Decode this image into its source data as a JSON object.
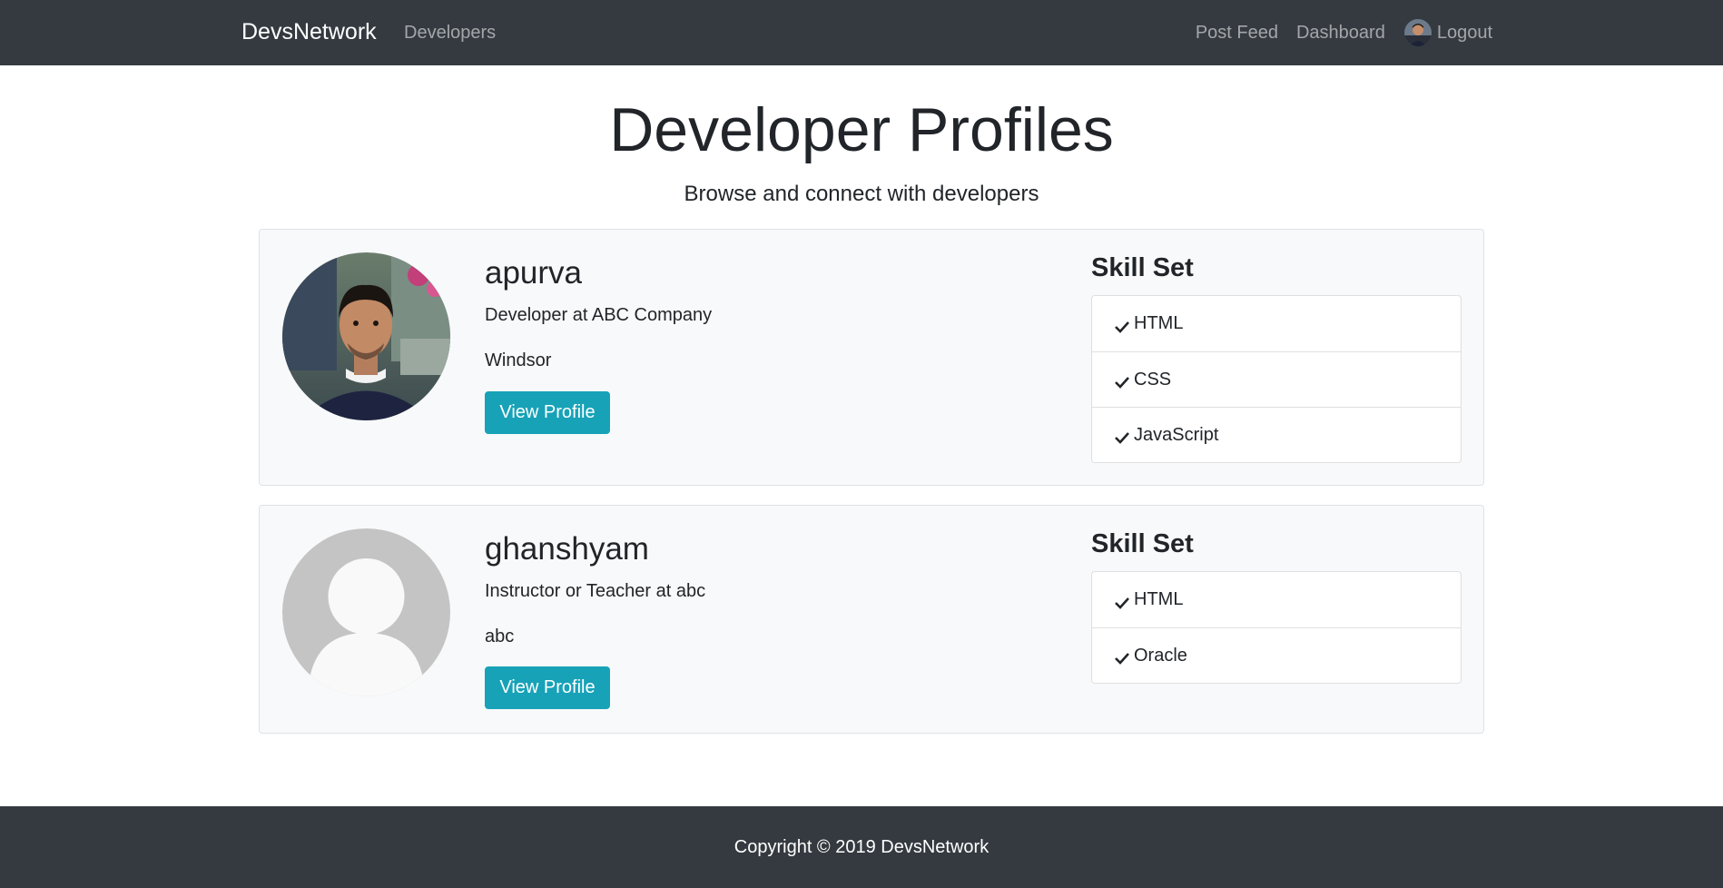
{
  "nav": {
    "brand": "DevsNetwork",
    "developers": "Developers",
    "post_feed": "Post Feed",
    "dashboard": "Dashboard",
    "logout": "Logout"
  },
  "header": {
    "title": "Developer Profiles",
    "subtitle": "Browse and connect with developers"
  },
  "profiles": [
    {
      "name": "apurva",
      "status": "Developer at ABC Company",
      "location": "Windsor",
      "button_label": "View Profile",
      "skills_title": "Skill Set",
      "skills": [
        "HTML",
        "CSS",
        "JavaScript"
      ],
      "avatar": "user-photo"
    },
    {
      "name": "ghanshyam",
      "status": "Instructor or Teacher at abc",
      "location": "abc",
      "button_label": "View Profile",
      "skills_title": "Skill Set",
      "skills": [
        "HTML",
        "Oracle"
      ],
      "avatar": "default-avatar"
    }
  ],
  "footer": {
    "copyright": "Copyright © 2019 DevsNetwork"
  },
  "colors": {
    "navbar": "#343a40",
    "card_bg": "#f8f9fa",
    "button": "#17a2b8"
  },
  "icons": {
    "skill_marker": "check-icon"
  }
}
